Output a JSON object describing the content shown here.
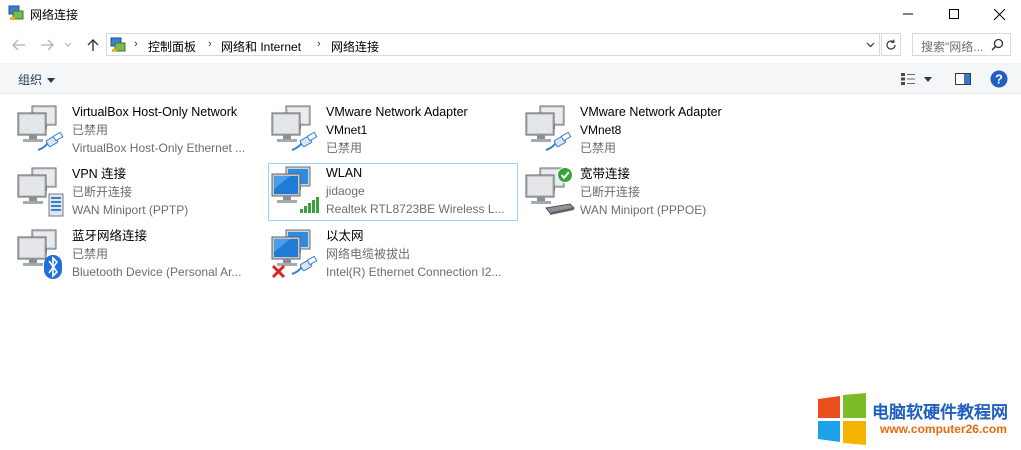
{
  "window": {
    "title": "网络连接"
  },
  "nav": {
    "breadcrumbs": [
      "控制面板",
      "网络和 Internet",
      "网络连接"
    ],
    "search_placeholder": "搜索\"网络..."
  },
  "toolbar": {
    "organize_label": "组织"
  },
  "items": [
    {
      "name": "VirtualBox Host-Only Network",
      "line2": "已禁用",
      "line3": "VirtualBox Host-Only Ethernet ...",
      "icon": "wired-adapter-icon",
      "overlay": "cable"
    },
    {
      "name": "VMware Network Adapter",
      "line2": "VMnet1",
      "line3": "已禁用",
      "icon": "wired-adapter-icon",
      "overlay": "cable"
    },
    {
      "name": "VMware Network Adapter",
      "line2": "VMnet8",
      "line3": "已禁用",
      "icon": "wired-adapter-icon",
      "overlay": "cable"
    },
    {
      "name": "VPN 连接",
      "line2": "已断开连接",
      "line3": "WAN Miniport (PPTP)",
      "icon": "vpn-adapter-icon",
      "overlay": "server"
    },
    {
      "name": "WLAN",
      "line2": "jidaoge",
      "line3": "Realtek RTL8723BE Wireless L...",
      "icon": "wifi-adapter-icon",
      "overlay": "signal"
    },
    {
      "name": "宽带连接",
      "line2": "已断开连接",
      "line3": "WAN Miniport (PPPOE)",
      "icon": "broadband-adapter-icon",
      "overlay": "modem-check"
    },
    {
      "name": "蓝牙网络连接",
      "line2": "已禁用",
      "line3": "Bluetooth Device (Personal Ar...",
      "icon": "bluetooth-adapter-icon",
      "overlay": "bluetooth"
    },
    {
      "name": "以太网",
      "line2": "网络电缆被拔出",
      "line3": "Intel(R) Ethernet Connection I2...",
      "icon": "ethernet-adapter-icon",
      "overlay": "cable-x"
    }
  ],
  "watermark": {
    "name": "电脑软硬件教程网",
    "url": "www.computer26.com"
  },
  "colors": {
    "toolbar_bg": "#f5f6f7",
    "selection_border": "#99d1ff",
    "secondary_text": "#6d6d6d",
    "organize_text": "#1e395b",
    "watermark_blue": "#1f5fbf",
    "watermark_orange": "#e8690c"
  }
}
